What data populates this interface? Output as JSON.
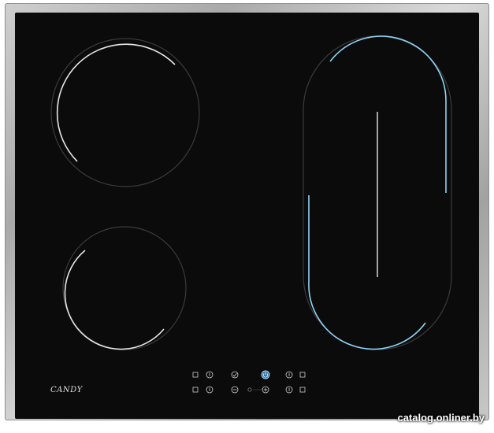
{
  "brand": {
    "logo_text": "CANDY"
  },
  "watermark": {
    "text": "catalog.onliner.by"
  },
  "colors": {
    "glass": "#0b0b0b",
    "zone_outline": "#3a3a3a",
    "zone_highlight_white": "#e6e6e6",
    "zone_highlight_blue": "#8fd3f4",
    "frame_steel": "#b9b9b9"
  },
  "controls": {
    "icons": [
      "zone-select-icon",
      "timer-icon",
      "check-icon",
      "power-icon",
      "minus-icon",
      "plus-icon",
      "lock-icon"
    ]
  }
}
